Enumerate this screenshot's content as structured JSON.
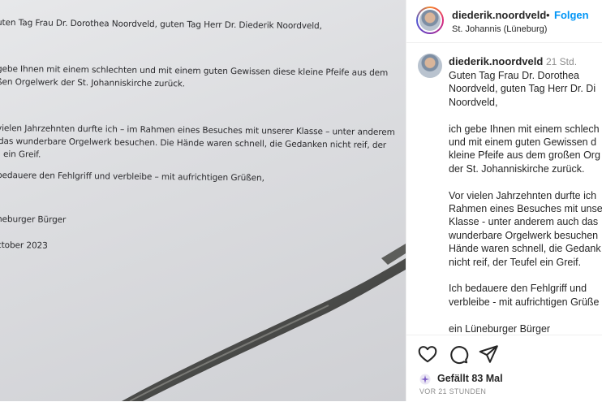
{
  "photo": {
    "lines": [
      "uten Tag Frau Dr. Dorothea Noordveld, guten Tag Herr Dr. Diederik Noordveld,",
      "gebe Ihnen mit einem schlechten und mit einem guten Gewissen diese kleine Pfeife aus dem",
      "ßen Orgelwerk der St. Johanniskirche zurück.",
      "vielen Jahrzehnten durfte ich – im Rahmen eines Besuches mit unserer Klasse – unter anderem",
      "das wunderbare Orgelwerk besuchen. Die Hände waren schnell, die Gedanken nicht reif, der",
      "ein Greif.",
      "bedauere den Fehlgriff und verbleibe – mit aufrichtigen Grüßen,",
      "neburger Bürger",
      "ctober 2023"
    ]
  },
  "header": {
    "username": "diederik.noordveld",
    "dot": "•",
    "follow_label": "Folgen",
    "location": "St. Johannis (Lüneburg)"
  },
  "comment": {
    "username": "diederik.noordveld",
    "time": "21 Std.",
    "paragraphs": [
      [
        "Guten Tag Frau Dr. Dorothea",
        "Noordveld, guten Tag Herr Dr. Di",
        "Noordveld,"
      ],
      [
        "ich gebe Ihnen mit einem schlech",
        "und mit einem guten Gewissen d",
        "kleine Pfeife aus dem großen Org",
        "der St. Johanniskirche zurück."
      ],
      [
        "Vor vielen Jahrzehnten durfte ich",
        "Rahmen eines Besuches mit unse",
        "Klasse - unter anderem auch das",
        "wunderbare Orgelwerk besuchen",
        "Hände waren schnell, die Gedank",
        "nicht reif, der Teufel ein Greif."
      ],
      [
        "Ich bedauere den Fehlgriff und",
        "verbleibe - mit aufrichtigen Grüße"
      ],
      [
        "ein Lüneburger Bürger"
      ]
    ]
  },
  "actions": {
    "icons": [
      "heart-icon",
      "comment-icon",
      "share-icon"
    ],
    "likes_label": "Gefällt 83 Mal",
    "time_ago": "VOR 21 STUNDEN"
  },
  "colors": {
    "accent": "#0095f6",
    "text": "#262626",
    "muted": "#8e8e8e",
    "divider": "#efefef"
  }
}
